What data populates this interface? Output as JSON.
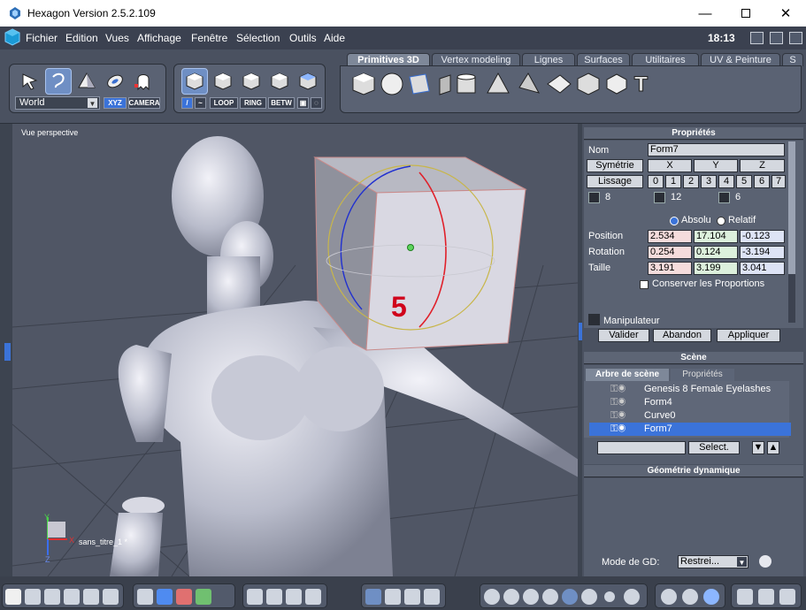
{
  "window": {
    "title": "Hexagon Version 2.5.2.109"
  },
  "menu": {
    "items": [
      "Fichier",
      "Edition",
      "Vues",
      "Affichage",
      "Fenêtre",
      "Sélection",
      "Outils",
      "Aide"
    ],
    "time": "18:13"
  },
  "toolbar": {
    "world_select": "World",
    "xyz_label": "XYZ",
    "camera_label": "CAMERA",
    "loop_label": "LOOP",
    "ring_label": "RING",
    "betw_label": "BETW"
  },
  "tabs": [
    {
      "label": "Primitives 3D",
      "active": true
    },
    {
      "label": "Vertex modeling",
      "active": false
    },
    {
      "label": "Lignes",
      "active": false
    },
    {
      "label": "Surfaces",
      "active": false
    },
    {
      "label": "Utilitaires",
      "active": false
    },
    {
      "label": "UV & Peinture",
      "active": false
    },
    {
      "label": "S",
      "active": false
    }
  ],
  "viewport": {
    "label": "Vue perspective",
    "annotation": "5",
    "object_label": "sans_titre_1 *",
    "axes": {
      "x": "X",
      "y": "Y",
      "z": "Z"
    }
  },
  "properties": {
    "title": "Propriétés",
    "name_label": "Nom",
    "name_value": "Form7",
    "symmetry_button": "Symétrie",
    "axes": [
      "X",
      "Y",
      "Z"
    ],
    "smoothing_button": "Lissage",
    "smoothing_levels": [
      "0",
      "1",
      "2",
      "3",
      "4",
      "5",
      "6",
      "7"
    ],
    "counts": [
      "8",
      "12",
      "6"
    ],
    "absolute_label": "Absolu",
    "relative_label": "Relatif",
    "position_label": "Position",
    "position": [
      "2.534",
      "17.104",
      "-0.123"
    ],
    "rotation_label": "Rotation",
    "rotation": [
      "0.254",
      "0.124",
      "-3.194"
    ],
    "size_label": "Taille",
    "size": [
      "3.191",
      "3.199",
      "3.041"
    ],
    "keep_proportions": "Conserver les Proportions",
    "manipulator": "Manipulateur",
    "validate_button": "Valider",
    "abandon_button": "Abandon",
    "apply_button": "Appliquer"
  },
  "scene": {
    "title": "Scène",
    "tab_tree": "Arbre de scène",
    "tab_props": "Propriétés",
    "items": [
      "Genesis 8 Female Eyelashes",
      "Form4",
      "Curve0",
      "Form7"
    ],
    "selected_index": 3,
    "select_button": "Select."
  },
  "geometry": {
    "title": "Géométrie dynamique",
    "mode_label": "Mode de GD:",
    "mode_value": "Restrei..."
  },
  "colors": {
    "accent": "#3b73d9",
    "annotation": "#d0021b"
  }
}
